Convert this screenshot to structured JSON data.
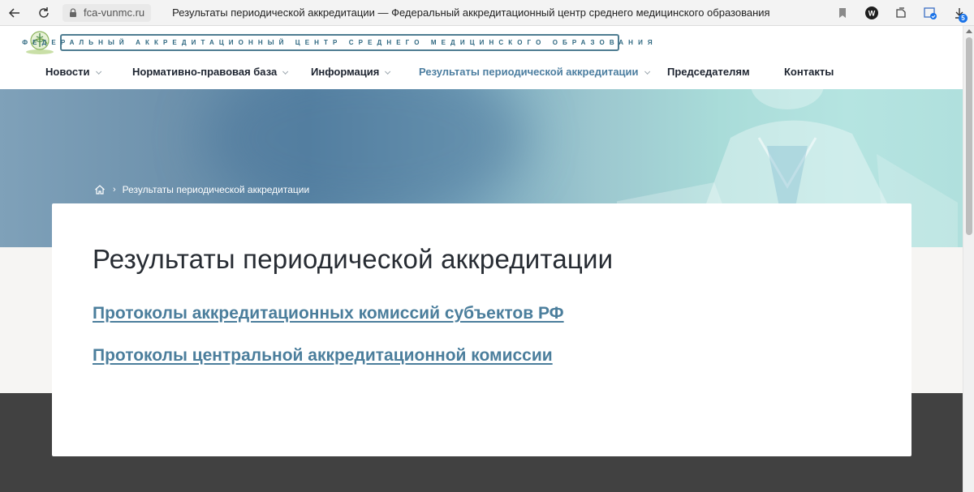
{
  "browser": {
    "url": "fca-vunmc.ru",
    "tab_title": "Результаты периодической аккредитации — Федеральный аккредитационный центр среднего медицинского образования",
    "download_count": "5",
    "icons": [
      "back-arrow-icon",
      "reload-icon",
      "lock-icon",
      "bookmark-icon",
      "extension-w-icon",
      "sidebar-icon",
      "profile-icon",
      "download-icon"
    ]
  },
  "header": {
    "brand": "Федеральный аккредитационный центр среднего медицинского образования",
    "nav": [
      {
        "label": "Новости",
        "has_dropdown": true
      },
      {
        "label": "Нормативно-правовая база",
        "has_dropdown": true
      },
      {
        "label": "Информация",
        "has_dropdown": true
      },
      {
        "label": "Результаты периодической аккредитации",
        "has_dropdown": true,
        "active": true
      },
      {
        "label": "Председателям",
        "has_dropdown": false
      },
      {
        "label": "Контакты",
        "has_dropdown": false
      }
    ]
  },
  "breadcrumb": {
    "current": "Результаты периодической аккредитации"
  },
  "main": {
    "title": "Результаты периодической аккредитации",
    "links": [
      "Протоколы аккредитационных комиссий субъектов РФ",
      "Протоколы центральной аккредитационной комиссии"
    ]
  },
  "colors": {
    "accent": "#4b7e9c",
    "nav_active": "#4c7ea0",
    "footer_dark": "#414141",
    "brand_border": "#4e7c91"
  }
}
